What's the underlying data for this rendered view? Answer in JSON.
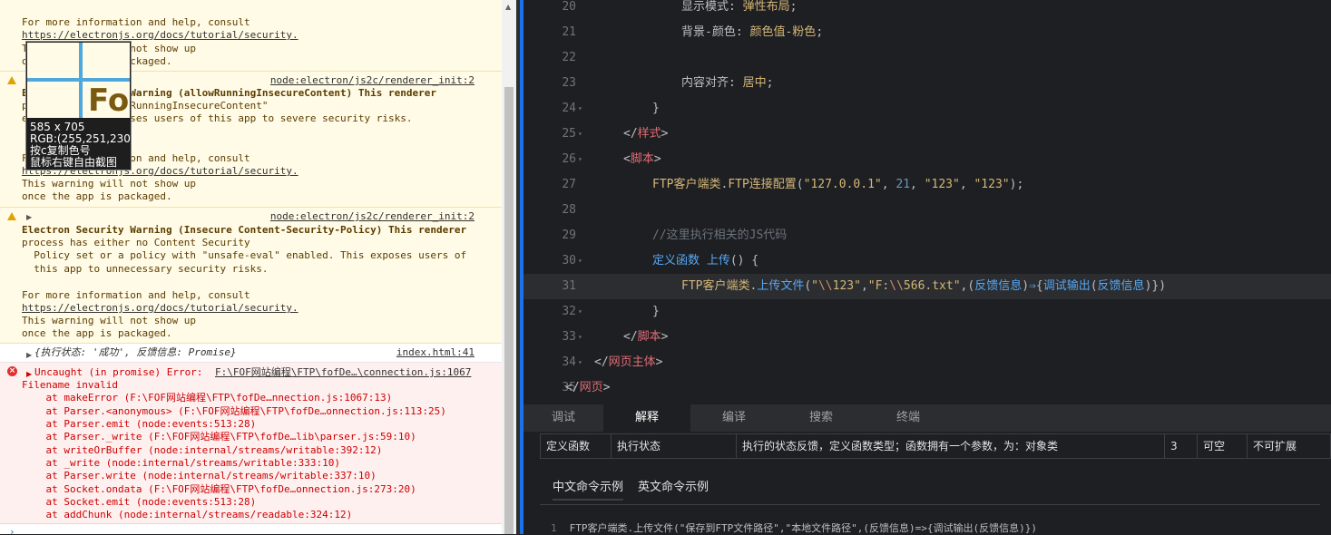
{
  "console": {
    "msg1": {
      "lines": [
        "For more information and help, consult",
        "https://electronjs.org/docs/tutorial/security.",
        "This warning will not show up",
        "once the app is packaged."
      ]
    },
    "msg2": {
      "source": "node:electron/js2c/renderer_init:2",
      "lines": [
        "Electron Security Warning (allowRunningInsecureContent) This renderer",
        "process has \"allowRunningInsecureContent\"",
        "enabled. This exposes users of this app to severe security risks.",
        "",
        "",
        "For more information and help, consult",
        "https://electronjs.org/docs/tutorial/security.",
        "This warning will not show up",
        "once the app is packaged."
      ]
    },
    "msg3": {
      "source": "node:electron/js2c/renderer_init:2",
      "lines": [
        "Electron Security Warning (Insecure Content-Security-Policy) This renderer",
        "process has either no Content Security",
        "  Policy set or a policy with \"unsafe-eval\" enabled. This exposes users of",
        "  this app to unnecessary security risks.",
        "",
        "For more information and help, consult",
        "https://electronjs.org/docs/tutorial/security.",
        "This warning will not show up",
        "once the app is packaged."
      ]
    },
    "msg4": {
      "text": "{执行状态: '成功', 反馈信息: Promise}",
      "source": "index.html:41"
    },
    "msg5": {
      "header": "Uncaught (in promise) Error:",
      "source": "F:\\FOF网站编程\\FTP\\fofDe…\\connection.js:1067",
      "lines": [
        "Filename invalid",
        "    at makeError (F:\\FOF网站编程\\FTP\\fofDe…nnection.js:1067:13)",
        "    at Parser.<anonymous> (F:\\FOF网站编程\\FTP\\fofDe…onnection.js:113:25)",
        "    at Parser.emit (node:events:513:28)",
        "    at Parser._write (F:\\FOF网站编程\\FTP\\fofDe…lib\\parser.js:59:10)",
        "    at writeOrBuffer (node:internal/streams/writable:392:12)",
        "    at _write (node:internal/streams/writable:333:10)",
        "    at Parser.write (node:internal/streams/writable:337:10)",
        "    at Socket.ondata (F:\\FOF网站编程\\FTP\\fofDe…onnection.js:273:20)",
        "    at Socket.emit (node:events:513:28)",
        "    at addChunk (node:internal/streams/readable:324:12)"
      ]
    },
    "prompt": "›"
  },
  "picker": {
    "size": "585 x 705",
    "rgb": "RGB:(255,251,230)",
    "hint1": "按c复制色号",
    "hint2": "鼠标右键自由截图",
    "glyph": "Fo"
  },
  "editor": {
    "lines": [
      {
        "n": "20",
        "indent": 4,
        "parts": [
          [
            "prop",
            "显示模式: "
          ],
          [
            "val",
            "弹性布局"
          ],
          [
            "prop",
            ";"
          ]
        ]
      },
      {
        "n": "21",
        "indent": 4,
        "parts": [
          [
            "prop",
            "背景-颜色: "
          ],
          [
            "val",
            "颜色值-粉色"
          ],
          [
            "prop",
            ";"
          ]
        ]
      },
      {
        "n": "22",
        "indent": 4,
        "parts": []
      },
      {
        "n": "23",
        "indent": 4,
        "parts": [
          [
            "prop",
            "内容对齐: "
          ],
          [
            "val",
            "居中"
          ],
          [
            "prop",
            ";"
          ]
        ]
      },
      {
        "n": "24",
        "indent": 3,
        "fold": true,
        "parts": [
          [
            "prop",
            "}"
          ]
        ]
      },
      {
        "n": "25",
        "indent": 2,
        "fold": true,
        "parts": [
          [
            "prop",
            "</"
          ],
          [
            "tag",
            "样式"
          ],
          [
            "prop",
            ">"
          ]
        ]
      },
      {
        "n": "26",
        "indent": 2,
        "fold": true,
        "parts": [
          [
            "prop",
            "<"
          ],
          [
            "tag",
            "脚本"
          ],
          [
            "prop",
            ">"
          ]
        ]
      },
      {
        "n": "27",
        "indent": 3,
        "parts": [
          [
            "val",
            "FTP客户端类"
          ],
          [
            "prop",
            "."
          ],
          [
            "val",
            "FTP连接配置"
          ],
          [
            "prop",
            "("
          ],
          [
            "str",
            "\"127.0.0.1\""
          ],
          [
            "prop",
            ", "
          ],
          [
            "num",
            "21"
          ],
          [
            "prop",
            ", "
          ],
          [
            "str",
            "\"123\""
          ],
          [
            "prop",
            ", "
          ],
          [
            "str",
            "\"123\""
          ],
          [
            "prop",
            ");"
          ]
        ]
      },
      {
        "n": "28",
        "indent": 3,
        "parts": []
      },
      {
        "n": "29",
        "indent": 3,
        "parts": [
          [
            "cmt",
            "//这里执行相关的JS代码"
          ]
        ]
      },
      {
        "n": "30",
        "indent": 3,
        "fold": true,
        "parts": [
          [
            "fn",
            "定义函数 上传"
          ],
          [
            "prop",
            "() {"
          ]
        ]
      },
      {
        "n": "31",
        "indent": 4,
        "active": true,
        "parts": [
          [
            "val",
            "FTP客户端类"
          ],
          [
            "prop",
            "."
          ],
          [
            "fn",
            "上传文件"
          ],
          [
            "prop",
            "("
          ],
          [
            "str",
            "\""
          ],
          [
            "esc",
            "\\\\"
          ],
          [
            "str",
            "123\""
          ],
          [
            "prop",
            ","
          ],
          [
            "str",
            "\"F:"
          ],
          [
            "esc",
            "\\\\"
          ],
          [
            "str",
            "566.txt\""
          ],
          [
            "prop",
            ",("
          ],
          [
            "fn",
            "反馈信息"
          ],
          [
            "prop",
            ")"
          ],
          [
            "fn",
            "⇒"
          ],
          [
            "prop",
            "{"
          ],
          [
            "fn",
            "调试输出"
          ],
          [
            "prop",
            "("
          ],
          [
            "fn",
            "反馈信息"
          ],
          [
            "prop",
            ")})"
          ]
        ]
      },
      {
        "n": "32",
        "indent": 3,
        "fold": true,
        "parts": [
          [
            "prop",
            "}"
          ]
        ]
      },
      {
        "n": "33",
        "indent": 2,
        "fold": true,
        "parts": [
          [
            "prop",
            "</"
          ],
          [
            "tag",
            "脚本"
          ],
          [
            "prop",
            ">"
          ]
        ]
      },
      {
        "n": "34",
        "indent": 1,
        "fold": true,
        "parts": [
          [
            "prop",
            "</"
          ],
          [
            "tag",
            "网页主体"
          ],
          [
            "prop",
            ">"
          ]
        ]
      },
      {
        "n": "35",
        "indent": 0,
        "parts": [
          [
            "prop",
            "</"
          ],
          [
            "tag",
            "网页"
          ],
          [
            "prop",
            ">"
          ]
        ]
      }
    ]
  },
  "bottom": {
    "tabs": [
      "调试",
      "解释",
      "编译",
      "搜索",
      "终端"
    ],
    "active_tab": "解释",
    "info": [
      "定义函数",
      "执行状态",
      "执行的状态反馈，定义函数类型；函数拥有一个参数，为：对象类",
      "3",
      "可空",
      "不可扩展"
    ],
    "example_tabs": [
      "中文命令示例",
      "英文命令示例"
    ],
    "example_line_no": "1",
    "example_code": "FTP客户端类.上传文件(\"保存到FTP文件路径\",\"本地文件路径\",(反馈信息)=>{调试输出(反馈信息)})"
  },
  "colors": {
    "warning_bg": "#fffbe6",
    "error_bg": "#fff0f0",
    "editor_bg": "#1e1f22",
    "accent": "#1a73e8"
  }
}
